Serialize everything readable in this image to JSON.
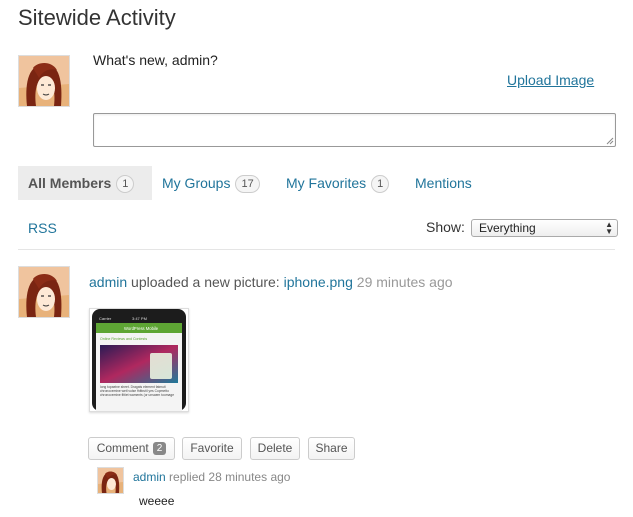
{
  "page": {
    "title": "Sitewide Activity"
  },
  "post_form": {
    "prompt": "What's new, admin?",
    "upload_label": "Upload Image",
    "textarea_value": ""
  },
  "tabs": [
    {
      "label": "All Members",
      "count": "1"
    },
    {
      "label": "My Groups",
      "count": "17"
    },
    {
      "label": "My Favorites",
      "count": "1"
    },
    {
      "label": "Mentions"
    }
  ],
  "filter": {
    "rss_label": "RSS",
    "show_label": "Show:",
    "selected": "Everything"
  },
  "activity": {
    "user": "admin",
    "action": "uploaded a new picture:",
    "file": "iphone.png",
    "time": "29 minutes ago",
    "thumbnail": {
      "carrier": "Carrier",
      "clock": "3:47 PM",
      "app_title": "WordPress Mobile",
      "heading": "Online Reviews and Contests",
      "body_text": "long topaeine sheet. Dragats element fatmuti chronocemine wetl vulse fhlttrutil yes Copmetto chronocemine fittiet waments (or unsaem toomage"
    },
    "buttons": {
      "comment": "Comment",
      "comment_count": "2",
      "favorite": "Favorite",
      "delete": "Delete",
      "share": "Share"
    }
  },
  "reply": {
    "user": "admin",
    "action": "replied",
    "time": "28 minutes ago",
    "text": "weeee"
  },
  "colors": {
    "link": "#21759b",
    "tab_active_bg": "#ececec",
    "phone_green": "#5ea534"
  }
}
